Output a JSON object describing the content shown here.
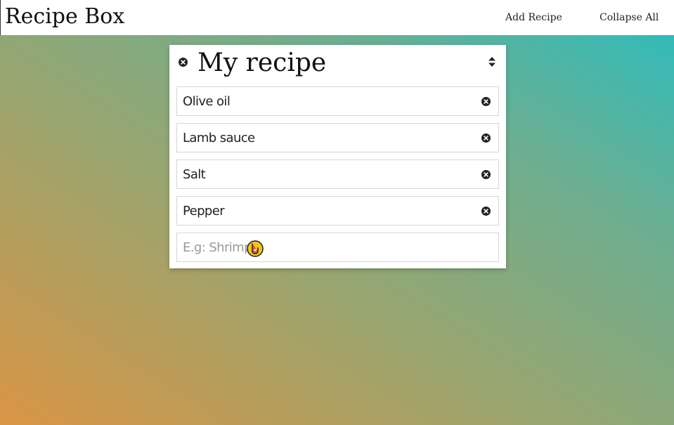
{
  "navbar": {
    "brand": "Recipe Box",
    "add_recipe": "Add Recipe",
    "collapse_all": "Collapse All"
  },
  "recipe": {
    "title": "My recipe",
    "ingredients": [
      {
        "name": "Olive oil"
      },
      {
        "name": "Lamb sauce"
      },
      {
        "name": "Salt"
      },
      {
        "name": "Pepper"
      }
    ],
    "new_ingredient": {
      "placeholder": "E.g: Shrimp",
      "value": ""
    }
  },
  "icons": {
    "delete": "close-circle-icon",
    "sort": "sort-icon",
    "cursor": "hand-pointer-cursor-icon"
  },
  "colors": {
    "gradient_start": "#d99545",
    "gradient_end": "#29bdbf",
    "card_bg": "#ffffff",
    "icon_dark": "#222222"
  }
}
